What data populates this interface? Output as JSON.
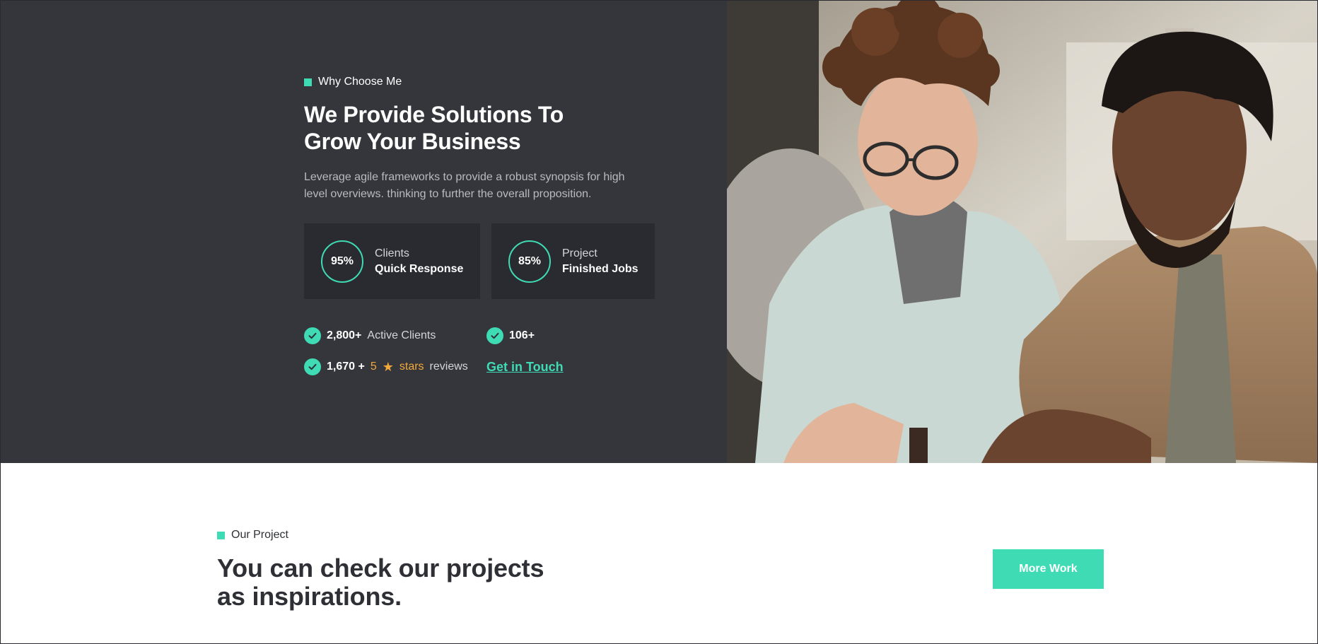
{
  "colors": {
    "accent": "#3fdbb4",
    "dark_bg": "#35363b",
    "card_bg": "#2a2b30",
    "star": "#f2a93b"
  },
  "why": {
    "tag": "Why Choose Me",
    "title_line1": "We Provide Solutions To",
    "title_line2": "Grow Your Business",
    "desc_line1": "Leverage agile frameworks to provide a robust synopsis for high",
    "desc_line2": "level overviews. thinking to further the overall proposition.",
    "stats": [
      {
        "percent": "95%",
        "label": "Clients",
        "sub": "Quick Response"
      },
      {
        "percent": "85%",
        "label": "Project",
        "sub": "Finished Jobs"
      }
    ],
    "facts": {
      "active_count": "2,800+",
      "active_label": "Active Clients",
      "count_106": "106+",
      "reviews_count": "1,670 +",
      "stars_num": "5",
      "stars_word": "stars",
      "reviews_label": "reviews",
      "touch_link": "Get in Touch"
    },
    "icons": [
      "check-icon",
      "star-icon"
    ]
  },
  "project": {
    "tag": "Our Project",
    "title_line1": "You can check our projects",
    "title_line2": "as inspirations.",
    "button": "More Work"
  }
}
